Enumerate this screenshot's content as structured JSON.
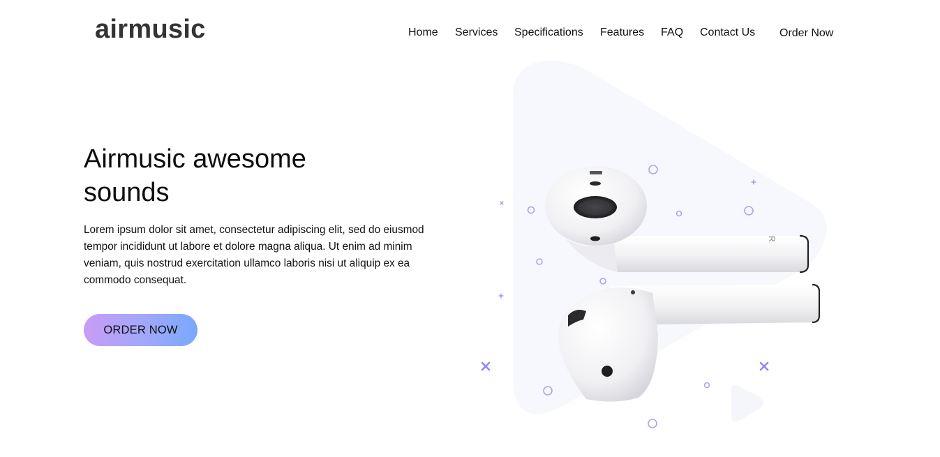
{
  "header": {
    "logo": "airmusic",
    "nav": [
      {
        "label": "Home"
      },
      {
        "label": "Services"
      },
      {
        "label": "Specifications"
      },
      {
        "label": "Features"
      },
      {
        "label": "FAQ"
      },
      {
        "label": "Contact Us"
      },
      {
        "label": "Order Now"
      }
    ]
  },
  "hero": {
    "title_line1": "Airmusic awesome",
    "title_line2": "sounds",
    "text": "Lorem ipsum dolor sit amet, consectetur adipiscing elit, sed do eiusmod tempor incididunt ut labore et dolore magna aliqua. Ut enim ad minim veniam, quis nostrud exercitation ullamco laboris nisi ut aliquip ex ea commodo consequat.",
    "cta_label": "ORDER NOW"
  },
  "colors": {
    "accent_start": "#c79cf6",
    "accent_end": "#79a8fb",
    "decor": "#9c97f0",
    "triangle_bg": "#f7f8fd"
  },
  "illustration": {
    "image": "airpods-product-image",
    "earbud_letter": "R"
  }
}
